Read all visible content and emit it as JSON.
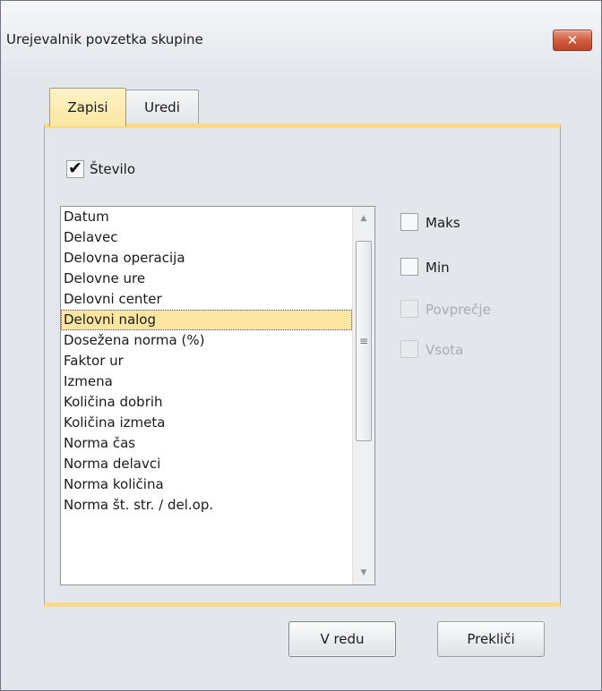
{
  "window": {
    "title": "Urejevalnik povzetka skupine",
    "close_label": "✕"
  },
  "tabs": [
    {
      "label": "Zapisi",
      "active": true
    },
    {
      "label": "Uredi",
      "active": false
    }
  ],
  "count_checkbox": {
    "label": "Število",
    "checked": true
  },
  "fields_list": {
    "items": [
      "Datum",
      "Delavec",
      "Delovna operacija",
      "Delovne ure",
      "Delovni center",
      "Delovni nalog",
      "Dosežena norma (%)",
      "Faktor ur",
      "Izmena",
      "Količina dobrih",
      "Količina izmeta",
      "Norma čas",
      "Norma delavci",
      "Norma količina",
      "Norma št. str. / del.op."
    ],
    "selected": "Delovni nalog"
  },
  "summary_options": [
    {
      "label": "Maks",
      "enabled": true,
      "checked": false
    },
    {
      "label": "Min",
      "enabled": true,
      "checked": false
    },
    {
      "label": "Povprečje",
      "enabled": false,
      "checked": false
    },
    {
      "label": "Vsota",
      "enabled": false,
      "checked": false
    }
  ],
  "buttons": {
    "ok": "V redu",
    "cancel": "Prekliči"
  },
  "colors": {
    "accent": "#fce6a1",
    "tab_band": "#fbd98b",
    "close": "#cf5a3c"
  }
}
